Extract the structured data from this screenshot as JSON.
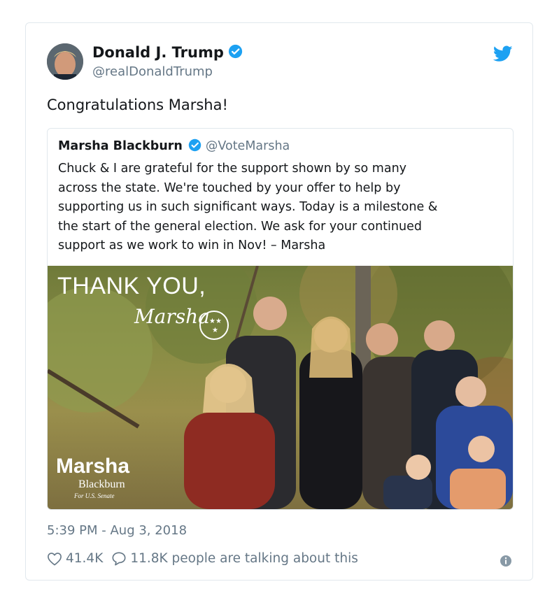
{
  "author": {
    "display_name": "Donald J. Trump",
    "handle": "@realDonaldTrump",
    "verified": true,
    "avatar": "profile-photo"
  },
  "tweet": {
    "text": "Congratulations Marsha!",
    "timestamp": "5:39 PM - Aug 3, 2018"
  },
  "quoted_tweet": {
    "display_name": "Marsha Blackburn",
    "handle": "@VoteMarsha",
    "verified": true,
    "lines": [
      "Chuck & I are grateful for the support shown by so many",
      "across the state. We're touched by your offer to help by",
      "supporting us in such significant ways. Today is a milestone &",
      "the start of the general election. We ask for your continued",
      "support as we work to win in Nov!  – Marsha"
    ],
    "image": {
      "headline": "THANK YOU,",
      "signature": "Marsha",
      "logo_name": "Marsha",
      "logo_sub": "Blackburn",
      "logo_tagline": "For U.S. Senate"
    }
  },
  "actions": {
    "likes": "41.4K",
    "replies": "11.8K people are talking about this"
  },
  "icons": {
    "brand": "twitter-bird-icon",
    "verified": "verified-badge-icon",
    "like": "heart-icon",
    "reply": "speech-bubble-icon",
    "info": "info-icon"
  },
  "colors": {
    "brand_blue": "#1da1f2",
    "text_primary": "#14171a",
    "text_secondary": "#657786",
    "border": "#e1e8ed"
  }
}
